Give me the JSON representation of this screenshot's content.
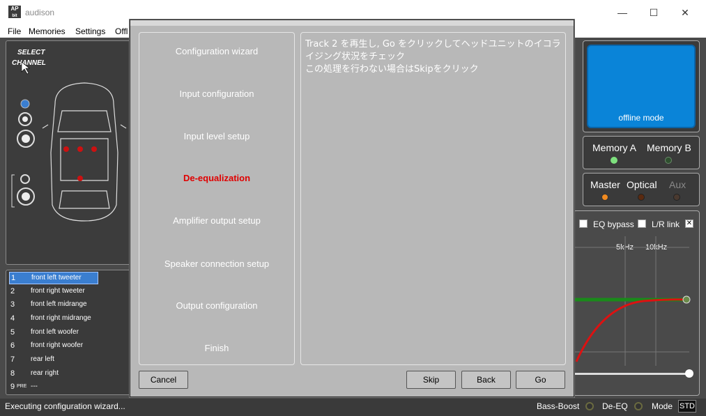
{
  "window": {
    "title": "audison",
    "app_icon_text": "AP",
    "app_icon_sub": "bit"
  },
  "menubar": {
    "items": [
      "File",
      "Memories",
      "Settings",
      "Offl"
    ]
  },
  "left_panel": {
    "select_label_1": "SELECT",
    "select_label_2": "CHANNEL"
  },
  "channels": [
    {
      "num": "1",
      "name": "front left tweeter"
    },
    {
      "num": "2",
      "name": "front right tweeter"
    },
    {
      "num": "3",
      "name": "front left midrange"
    },
    {
      "num": "4",
      "name": "front right midrange"
    },
    {
      "num": "5",
      "name": "front left woofer"
    },
    {
      "num": "6",
      "name": "front right woofer"
    },
    {
      "num": "7",
      "name": "rear left"
    },
    {
      "num": "8",
      "name": "rear right"
    },
    {
      "num": "9",
      "tag": "PRE",
      "name": "---"
    }
  ],
  "selected_channel_index": 0,
  "status": {
    "text": "Executing configuration wizard...",
    "bass_boost": "Bass-Boost",
    "de_eq": "De-EQ",
    "mode": "Mode",
    "mode_value": "STD"
  },
  "right_panel": {
    "offline": "offline mode",
    "memory_a": "Memory A",
    "memory_b": "Memory B",
    "master": "Master",
    "optical": "Optical",
    "aux": "Aux",
    "eq_bypass": "EQ bypass",
    "lr_link": "L/R link",
    "freq_5k": "5kHz",
    "freq_10k": "10kHz",
    "colors": {
      "memory_a_led": "#7ee07e",
      "memory_b_led": "#2f4f2f",
      "master_led": "#f08a20",
      "optical_led": "#5a2a10",
      "aux_led": "#4a3a30",
      "aux_text": "#8a8a8a"
    }
  },
  "dialog": {
    "steps": [
      "Configuration wizard",
      "Input configuration",
      "Input level setup",
      "De-equalization",
      "Amplifier output setup",
      "Speaker connection setup",
      "Output configuration",
      "Finish"
    ],
    "active_step": 3,
    "message_line1": "Track 2 を再生し, Go をクリックしてヘッドユニットのイコライジング状況をチェック",
    "message_line2": "この処理を行わない場合はSkipをクリック",
    "buttons": {
      "cancel": "Cancel",
      "skip": "Skip",
      "back": "Back",
      "go": "Go"
    }
  }
}
